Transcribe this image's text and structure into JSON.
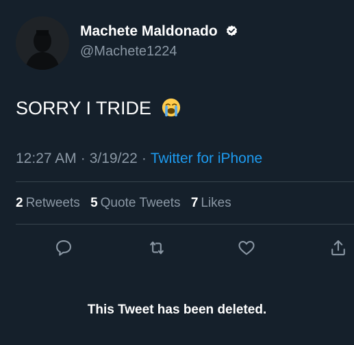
{
  "author": {
    "display_name": "Machete Maldonado",
    "handle": "@Machete1224",
    "verified_icon": "verified-badge-icon",
    "avatar_icon": "default-silhouette-avatar"
  },
  "tweet": {
    "text": "SORRY I TRIDE",
    "emoji": "loudly-crying-face-emoji",
    "time": "12:27 AM",
    "separator": "·",
    "date": "3/19/22",
    "source": "Twitter for iPhone"
  },
  "stats": {
    "retweets_count": "2",
    "retweets_label": "Retweets",
    "quote_tweets_count": "5",
    "quote_tweets_label": "Quote Tweets",
    "likes_count": "7",
    "likes_label": "Likes"
  },
  "actions": [
    "reply-icon",
    "retweet-icon",
    "like-icon",
    "share-icon"
  ],
  "notice": {
    "text": "This Tweet has been deleted."
  },
  "colors": {
    "background": "#15202b",
    "secondary_text": "#8b98a5",
    "accent": "#1d9bf0",
    "divider": "#38444d"
  }
}
